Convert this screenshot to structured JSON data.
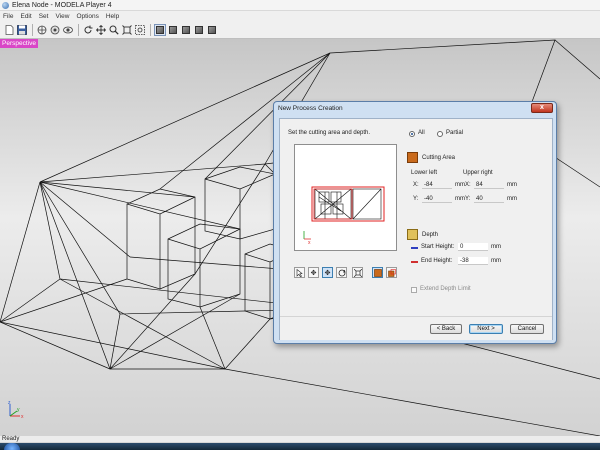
{
  "window": {
    "title": "Elena Node - MODELA Player 4"
  },
  "menu": [
    "File",
    "Edit",
    "Set",
    "View",
    "Options",
    "Help"
  ],
  "toolbar": {
    "buttons": [
      "new-file",
      "save",
      "model-position",
      "zoom-fit",
      "eye",
      "rotate",
      "pan",
      "zoom",
      "fit",
      "zoom-window",
      "view-perspective",
      "view-top",
      "view-front",
      "view-side",
      "view-iso"
    ]
  },
  "viewport": {
    "label": "Perspective"
  },
  "status": {
    "text": "Ready"
  },
  "dialog": {
    "title": "New Process Creation",
    "close_label": "x",
    "instruction": "Set the cutting area and depth.",
    "radio_all": "All",
    "radio_partial": "Partial",
    "selected_area_mode": "All",
    "cutting_area_title": "Cutting Area",
    "lower_left_label": "Lower left",
    "upper_right_label": "Upper right",
    "ll_x_label": "X:",
    "ll_x_value": "-84",
    "ll_x_unit": "mm",
    "ll_y_label": "Y:",
    "ll_y_value": "-40",
    "ll_y_unit": "mm",
    "ur_x_label": "X:",
    "ur_x_value": "84",
    "ur_x_unit": "mm",
    "ur_y_label": "Y:",
    "ur_y_value": "40",
    "ur_y_unit": "mm",
    "depth_title": "Depth",
    "start_height_label": "Start Height:",
    "start_height_value": "0",
    "start_height_unit": "mm",
    "end_height_label": "End Height:",
    "end_height_value": "-38",
    "end_height_unit": "mm",
    "extend_depth_label": "Extend Depth Limit",
    "extend_depth_checked": false,
    "start_color": "#3040c0",
    "end_color": "#d03030",
    "buttons": {
      "back": "< Back",
      "next": "Next >",
      "cancel": "Cancel"
    }
  },
  "colors": {
    "view_label_bg": "#d946c7",
    "axis_x": "#e03030",
    "axis_y": "#20a020",
    "axis_z": "#3060d0",
    "area_frame": "#e02020"
  }
}
